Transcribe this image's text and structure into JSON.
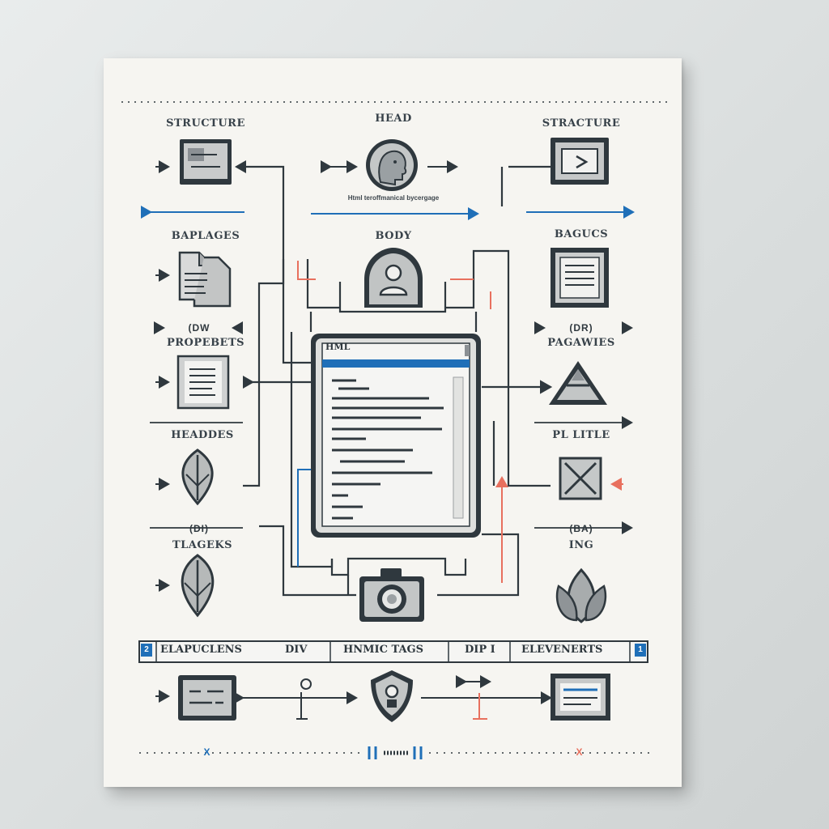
{
  "labels": {
    "structure_left": "STRUCTURE",
    "head": "HEAD",
    "structure_right": "STRACTURE",
    "baplages": "BAPLAGES",
    "body": "BODY",
    "bagucs": "BAGUCS",
    "propebets": "PROPEBETS",
    "pagawies": "PAGAWIES",
    "headdes": "HEADDES",
    "pl_litle": "PL LITLE",
    "tlageks": "TLAGEKS",
    "img": "ING",
    "html_window": "HML"
  },
  "tags": {
    "dw_left": "(DW",
    "dr_right": "(DR)",
    "di_left": "(DI)",
    "ba_right": "(BA)"
  },
  "captions": {
    "head_caption": "Html teroffmanical bycergage"
  },
  "strip": {
    "badge_left": "2",
    "seg1": "ELAPUCLENS",
    "seg2": "DIV",
    "seg3": "HNMIC TAGS",
    "seg4": "DIP I",
    "seg5": "ELEVENERTS",
    "badge_right": "1"
  },
  "footer": {
    "left_mark": "X",
    "right_mark": "X"
  },
  "colors": {
    "line": "#2f383e",
    "accent_blue": "#1f6fb8",
    "accent_red": "#e8705e",
    "icon_fill": "#b9bcbc",
    "icon_dark": "#4a5056",
    "paper": "#f6f5f1"
  }
}
